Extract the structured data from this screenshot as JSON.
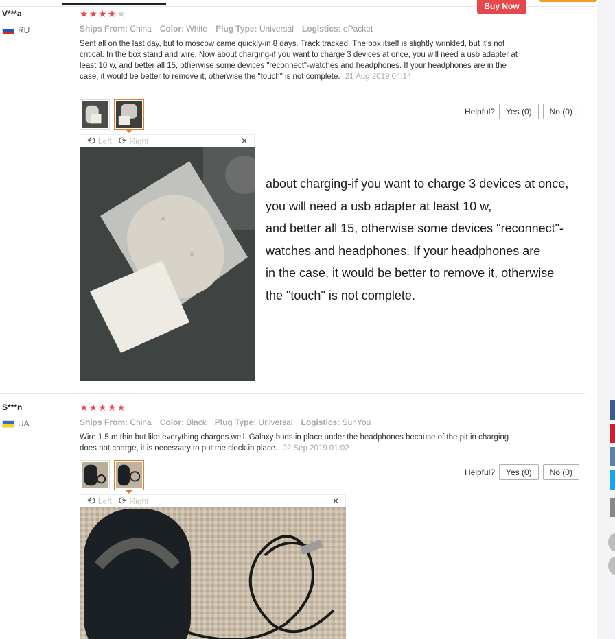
{
  "header": {
    "buy_now_label": "Buy Now"
  },
  "reviews": [
    {
      "user": "V***a",
      "country": "RU",
      "rating": 4,
      "stars": [
        "★",
        "★",
        "★",
        "★",
        "★"
      ],
      "meta": {
        "ships_from_label": "Ships From:",
        "ships_from": "China",
        "color_label": "Color:",
        "color": "White",
        "plug_label": "Plug Type:",
        "plug": "Universal",
        "logistics_label": "Logistics:",
        "logistics": "ePacket"
      },
      "text": "Sent all on the last day, but to moscow came quickly-in 8 days. Track tracked. The box itself is slightly wrinkled, but it's not critical. In the box stand and wire. Now about charging-if you want to charge 3 devices at once, you will need a usb adapter at least 10 w, and better all 15, otherwise some devices \"reconnect\"-watches and headphones. If your headphones are in the case, it would be better to remove it, otherwise the \"touch\" is not complete.",
      "date": "21 Aug 2019 04:14",
      "helpful_label": "Helpful?",
      "yes_label": "Yes (0)",
      "no_label": "No (0)",
      "viewer": {
        "left_label": "Left",
        "right_label": "Right",
        "close": "×"
      }
    },
    {
      "user": "S***n",
      "country": "UA",
      "rating": 5,
      "stars": [
        "★",
        "★",
        "★",
        "★",
        "★"
      ],
      "meta": {
        "ships_from_label": "Ships From:",
        "ships_from": "China",
        "color_label": "Color:",
        "color": "Black",
        "plug_label": "Plug Type:",
        "plug": "Universal",
        "logistics_label": "Logistics:",
        "logistics": "SunYou"
      },
      "text": "Wire 1.5 m thin but like everything charges well. Galaxy buds in place under the headphones because of the pit in charging does not charge, it is necessary to put the clock in place.",
      "date": "02 Sep 2019 01:02",
      "helpful_label": "Helpful?",
      "yes_label": "Yes (0)",
      "no_label": "No (0)",
      "viewer": {
        "left_label": "Left",
        "right_label": "Right",
        "close": "×"
      }
    }
  ],
  "annotation_lines": [
    "about charging-if you want to charge 3 devices at once,",
    "you will need a usb adapter at least 10 w,",
    "and better all 15, otherwise some devices \"reconnect\"-",
    "watches and headphones. If your headphones are",
    "in the case, it would be better to remove it, otherwise",
    "the \"touch\" is not complete."
  ],
  "colors": {
    "accent": "#e8474b",
    "orange": "#ee7b22",
    "muted": "#999999"
  }
}
